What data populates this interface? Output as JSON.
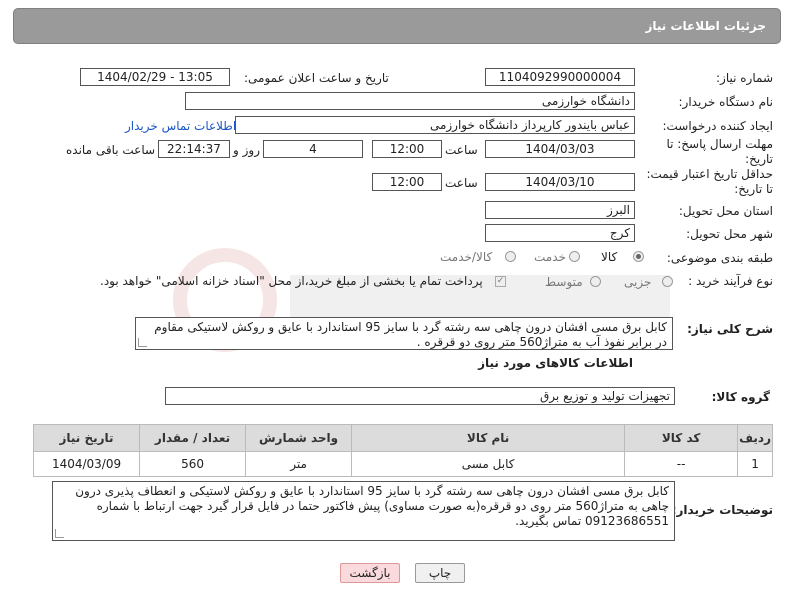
{
  "header": {
    "title": "جزئیات اطلاعات نیاز"
  },
  "form": {
    "need_number_label": "شماره نیاز:",
    "need_number": "1104092990000004",
    "announce_datetime_label": "تاریخ و ساعت اعلان عمومی:",
    "announce_datetime": "1404/02/29 - 13:05",
    "buyer_org_label": "نام دستگاه خریدار:",
    "buyer_org": "دانشگاه خوارزمی",
    "requester_label": "ایجاد کننده درخواست:",
    "requester": "عباس بایندور کارپرداز دانشگاه خوارزمی",
    "buyer_contact_link": "اطلاعات تماس خریدار",
    "reply_deadline_label_1": "مهلت ارسال پاسخ: تا",
    "reply_deadline_label_2": "تاریخ:",
    "reply_date": "1404/03/03",
    "time_label": "ساعت",
    "reply_time": "12:00",
    "days_value": "4",
    "days_label": "روز و",
    "remaining_time": "22:14:37",
    "remaining_label": "ساعت باقی مانده",
    "price_validity_label_1": "حداقل تاریخ اعتبار قیمت:",
    "price_validity_label_2": "تا تاریخ:",
    "price_validity_date": "1404/03/10",
    "price_validity_time": "12:00",
    "province_label": "استان محل تحویل:",
    "province": "البرز",
    "city_label": "شهر محل تحویل:",
    "city": "کرج",
    "category_label": "طبقه بندی موضوعی:",
    "category_options": [
      "کالا",
      "خدمت",
      "کالا/خدمت"
    ],
    "process_label": "نوع فرآیند خرید :",
    "process_options": [
      "جزیی",
      "متوسط"
    ],
    "payment_note": "پرداخت تمام یا بخشی از مبلغ خرید،از محل \"اسناد خزانه اسلامی\" خواهد بود.",
    "description_label": "شرح کلی نیاز:",
    "description": "کابل برق مسی افشان درون چاهی سه رشته گرد با سایز 95 استاندارد با عایق و روکش لاستیکی مقاوم در برابر نفوذ آب به متراژ560 متر روی دو قرقره .",
    "goods_info_title": "اطلاعات کالاهای مورد نیاز",
    "goods_group_label": "گروه کالا:",
    "goods_group": "تجهیزات تولید و توزیع برق"
  },
  "table": {
    "headers": [
      "ردیف",
      "کد کالا",
      "نام کالا",
      "واحد شمارش",
      "تعداد / مقدار",
      "تاریخ نیاز"
    ],
    "rows": [
      [
        "1",
        "--",
        "کابل مسی",
        "متر",
        "560",
        "1404/03/09"
      ]
    ]
  },
  "buyer_notes_label": "توضیحات خریدار:",
  "buyer_notes": "کابل  برق مسی افشان درون چاهی سه رشته گرد با سایز 95 استاندارد با عایق و روکش لاستیکی و انعطاف پذیری درون چاهی  به متراژ560 متر روی دو قرقره(به صورت مساوی) پیش فاکتور حتما در فایل قرار گیرد جهت ارتباط با شماره 09123686551 تماس بگیرید.",
  "buttons": {
    "print": "چاپ",
    "back": "بازگشت"
  }
}
